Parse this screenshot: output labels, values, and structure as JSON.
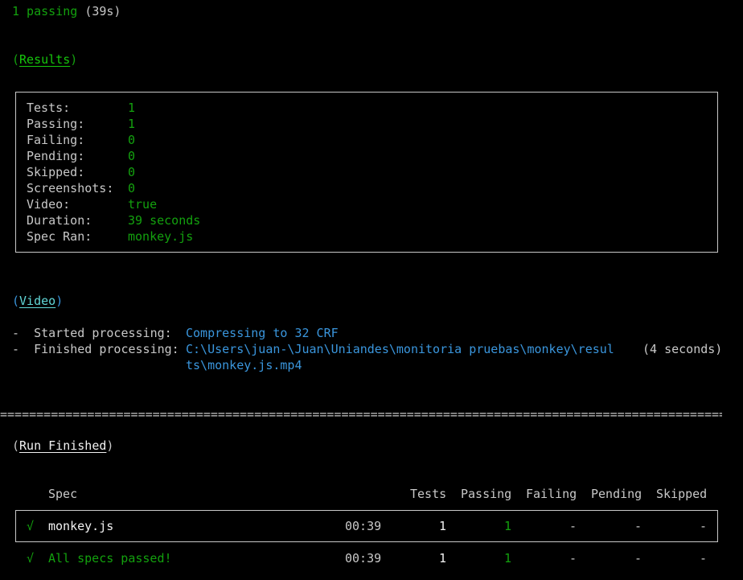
{
  "summary": {
    "passing_label": "1 passing",
    "duration": "(39s)"
  },
  "results": {
    "heading": "Results",
    "rows": [
      {
        "label": "Tests:",
        "value": "1"
      },
      {
        "label": "Passing:",
        "value": "1"
      },
      {
        "label": "Failing:",
        "value": "0"
      },
      {
        "label": "Pending:",
        "value": "0"
      },
      {
        "label": "Skipped:",
        "value": "0"
      },
      {
        "label": "Screenshots:",
        "value": "0"
      },
      {
        "label": "Video:",
        "value": "true"
      },
      {
        "label": "Duration:",
        "value": "39 seconds"
      },
      {
        "label": "Spec Ran:",
        "value": "monkey.js"
      }
    ]
  },
  "video": {
    "heading": "Video",
    "started_label": "Started processing:",
    "started_value": "Compressing to 32 CRF",
    "finished_label": "Finished processing:",
    "finished_path_line1": "C:\\Users\\juan-\\Juan\\Uniandes\\monitoria pruebas\\monkey\\resul",
    "finished_path_line2": "ts\\monkey.js.mp4",
    "finished_time": "(4 seconds)"
  },
  "separator": "===========================================================================================================================",
  "run_finished": {
    "heading": "Run Finished",
    "columns": {
      "spec": "Spec",
      "tests": "Tests",
      "passing": "Passing",
      "failing": "Failing",
      "pending": "Pending",
      "skipped": "Skipped"
    },
    "row": {
      "check": "√",
      "spec": "monkey.js",
      "time": "00:39",
      "tests": "1",
      "passing": "1",
      "failing": "-",
      "pending": "-",
      "skipped": "-"
    },
    "footer": {
      "check": "√",
      "message": "All specs passed!",
      "time": "00:39",
      "tests": "1",
      "passing": "1",
      "failing": "-",
      "pending": "-",
      "skipped": "-"
    }
  },
  "colors": {
    "background": "#000000",
    "text": "#c8c8c8",
    "green": "#13a10e",
    "bright_green": "#16c60c",
    "cyan": "#3a96dd",
    "bright_cyan": "#61d6d6"
  }
}
